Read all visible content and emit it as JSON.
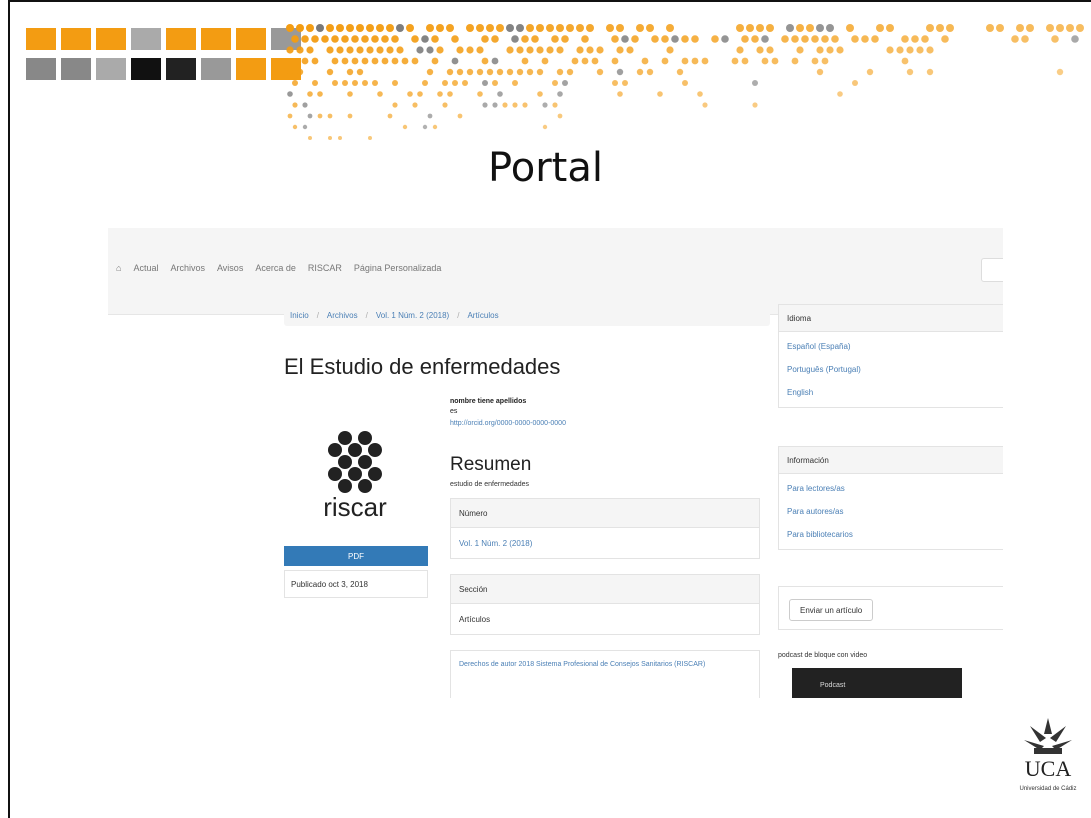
{
  "slide": {
    "title": "Portal"
  },
  "nav": {
    "items": [
      "Actual",
      "Archivos",
      "Avisos",
      "Acerca de",
      "RISCAR",
      "Página Personalizada"
    ]
  },
  "breadcrumb": [
    "Inicio",
    "Archivos",
    "Vol. 1 Núm. 2 (2018)",
    "Artículos"
  ],
  "article": {
    "title": "El Estudio de enfermedades",
    "author": "nombre tiene apellidos",
    "affiliation": "es",
    "orcid": "http://orcid.org/0000-0000-0000-0000",
    "pdf_label": "PDF",
    "published": "Publicado oct 3, 2018",
    "abstract_title": "Resumen",
    "abstract_text": "estudio de enfermedades",
    "issue_header": "Número",
    "issue_value": "Vol. 1 Núm. 2 (2018)",
    "section_header": "Sección",
    "section_value": "Artículos",
    "license_text": "Derechos de autor 2018 Sistema Profesional de Consejos Sanitarios (RISCAR)",
    "logo_text": "riscar"
  },
  "sidebar": {
    "language_title": "Idioma",
    "languages": [
      "Español (España)",
      "Português (Portugal)",
      "English"
    ],
    "info_title": "Información",
    "info_items": [
      "Para lectores/as",
      "Para autores/as",
      "Para bibliotecarios"
    ],
    "send_label": "Enviar un artículo",
    "podcast_label": "podcast de bloque con video",
    "video_caption": "Podcast"
  },
  "university": {
    "name": "UCA",
    "subtitle": "Universidad de Cádiz"
  },
  "colors": {
    "banner": "#f39c12",
    "link": "#4a7fb5",
    "button": "#337ab7"
  }
}
